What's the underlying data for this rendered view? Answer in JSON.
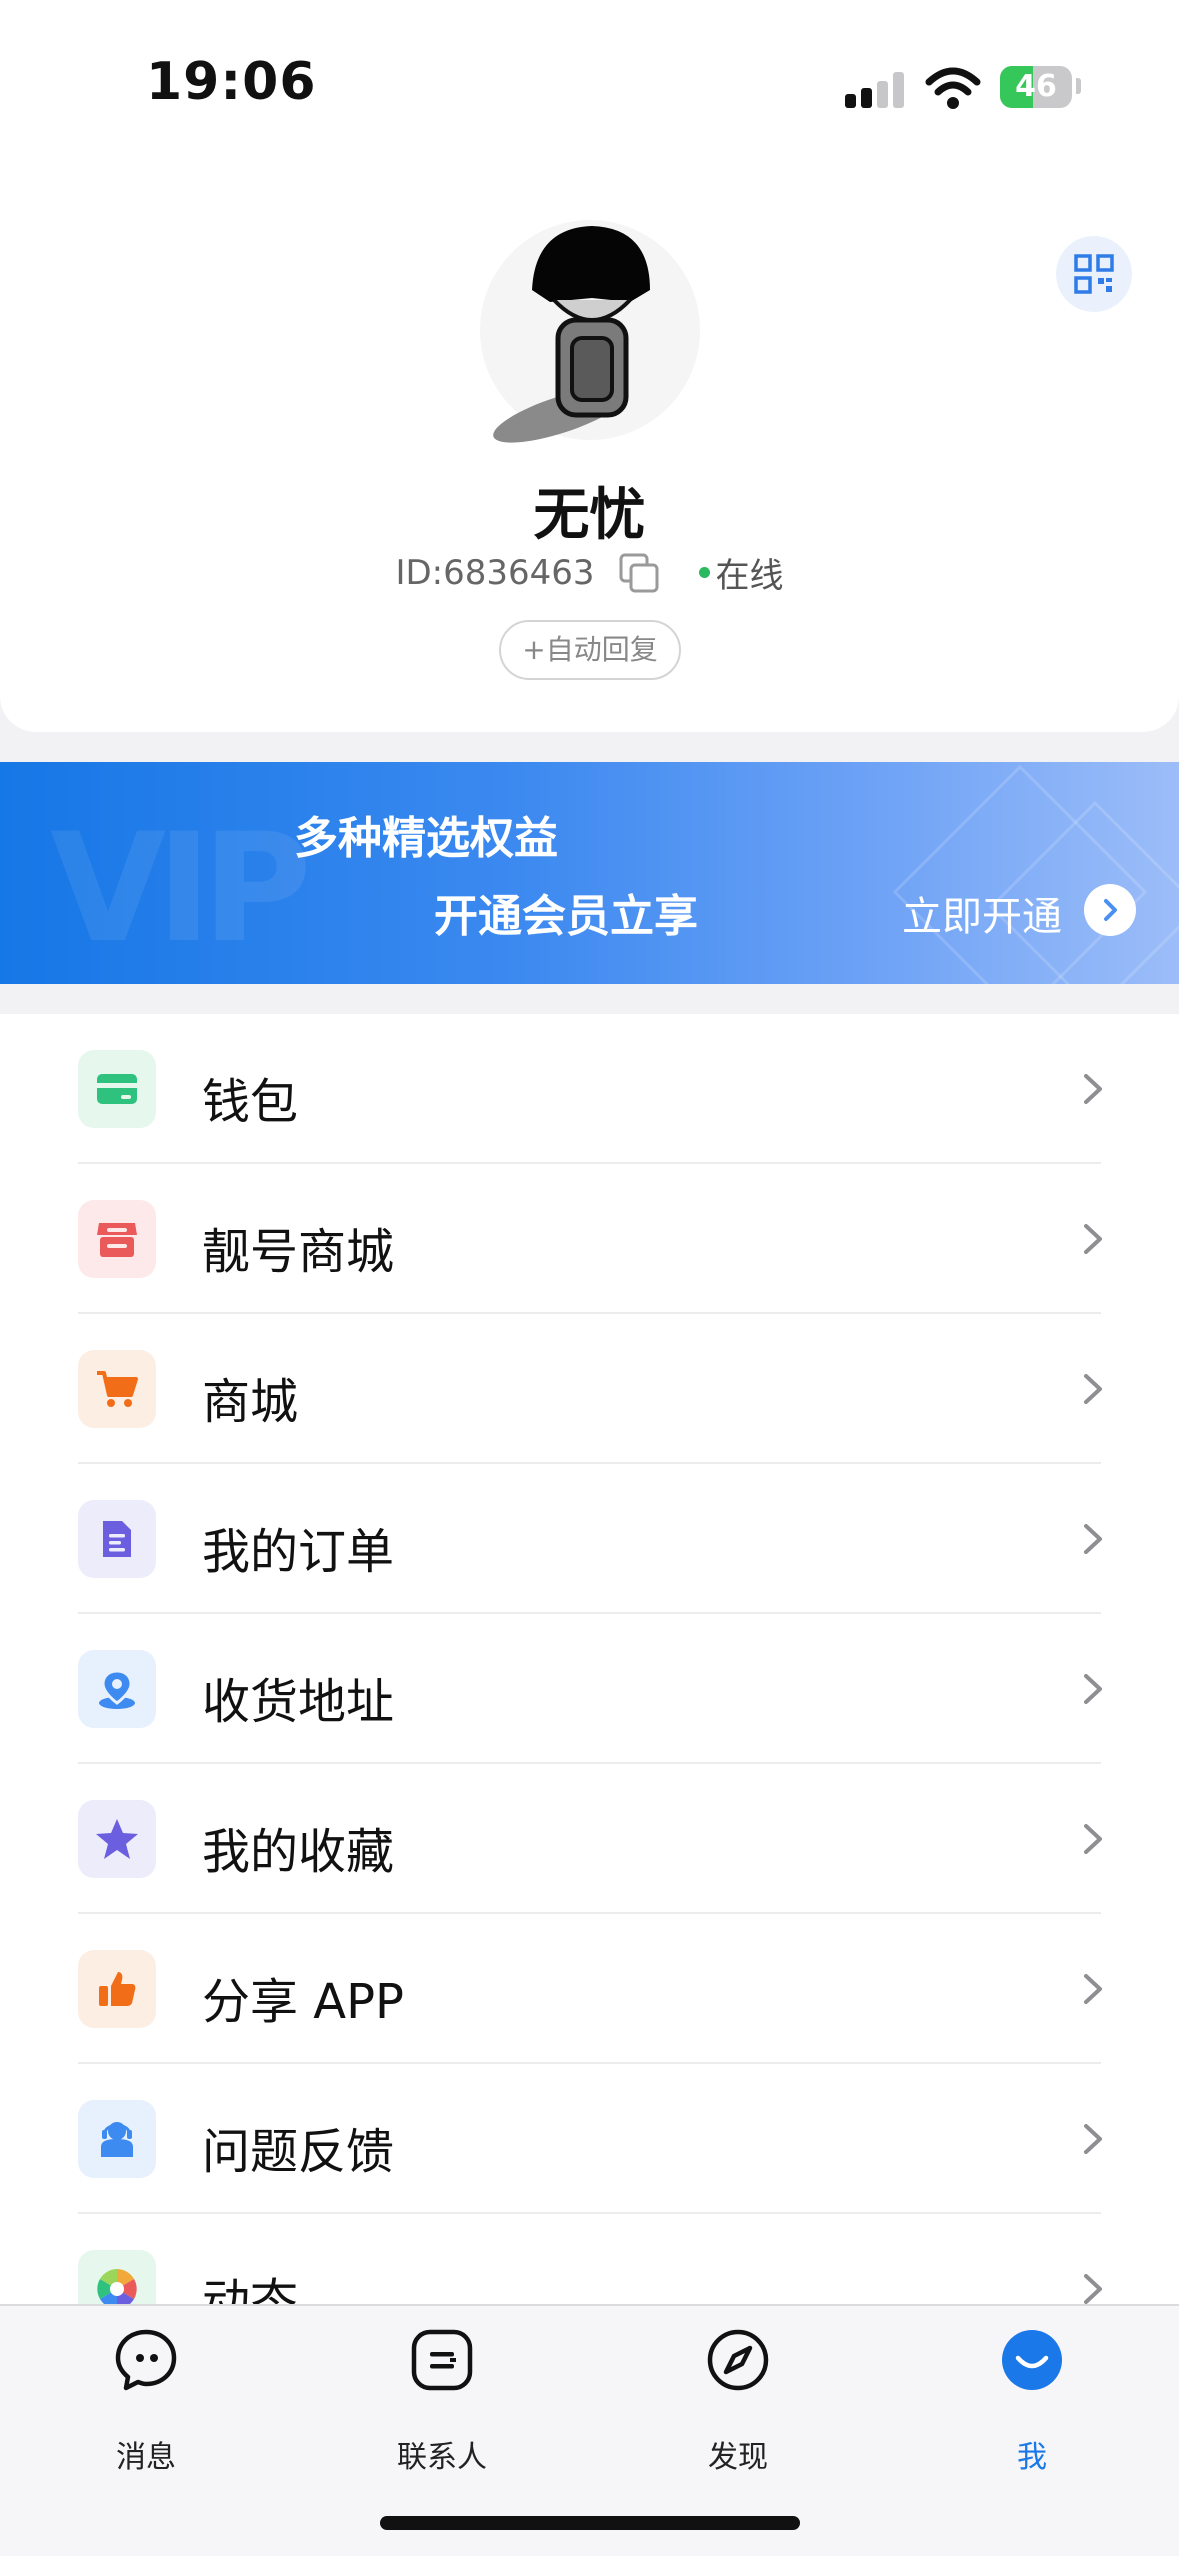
{
  "status_bar": {
    "time": "19:06",
    "battery": "46",
    "battery_level": 0.46
  },
  "profile": {
    "name": "无忧",
    "id_text": "ID:6836463",
    "online_label": "在线",
    "auto_reply_label": "+自动回复"
  },
  "vip_banner": {
    "line1": "多种精选权益",
    "line2": "开通会员立享",
    "cta": "立即开通",
    "watermark": "VIP"
  },
  "menu": {
    "items": [
      {
        "label": "钱包",
        "icon": "wallet-icon",
        "color": "#2ec27e",
        "bg": "#e6f7ee"
      },
      {
        "label": "靓号商城",
        "icon": "store-icon",
        "color": "#ea5a5a",
        "bg": "#fde9e9"
      },
      {
        "label": "商城",
        "icon": "cart-icon",
        "color": "#f26d17",
        "bg": "#fdeee3"
      },
      {
        "label": "我的订单",
        "icon": "order-document-icon",
        "color": "#6b5fe0",
        "bg": "#ececfb"
      },
      {
        "label": "收货地址",
        "icon": "location-pin-icon",
        "color": "#3d8af0",
        "bg": "#e7f0fd"
      },
      {
        "label": "我的收藏",
        "icon": "star-icon",
        "color": "#6b5fe0",
        "bg": "#ececfb"
      },
      {
        "label": "分享 APP",
        "icon": "thumbs-up-icon",
        "color": "#f26d17",
        "bg": "#fdeee3"
      },
      {
        "label": "问题反馈",
        "icon": "customer-service-icon",
        "color": "#3d8af0",
        "bg": "#e7f0fd"
      },
      {
        "label": "动态",
        "icon": "moments-aperture-icon",
        "color": "#f2a93b",
        "bg": "#e6f7ee"
      }
    ]
  },
  "tab_bar": {
    "tabs": [
      {
        "label": "消息",
        "icon": "message-bubble-icon"
      },
      {
        "label": "联系人",
        "icon": "contacts-icon"
      },
      {
        "label": "发现",
        "icon": "compass-icon"
      },
      {
        "label": "我",
        "icon": "profile-smile-icon"
      }
    ],
    "active_color": "#1a78e8"
  }
}
